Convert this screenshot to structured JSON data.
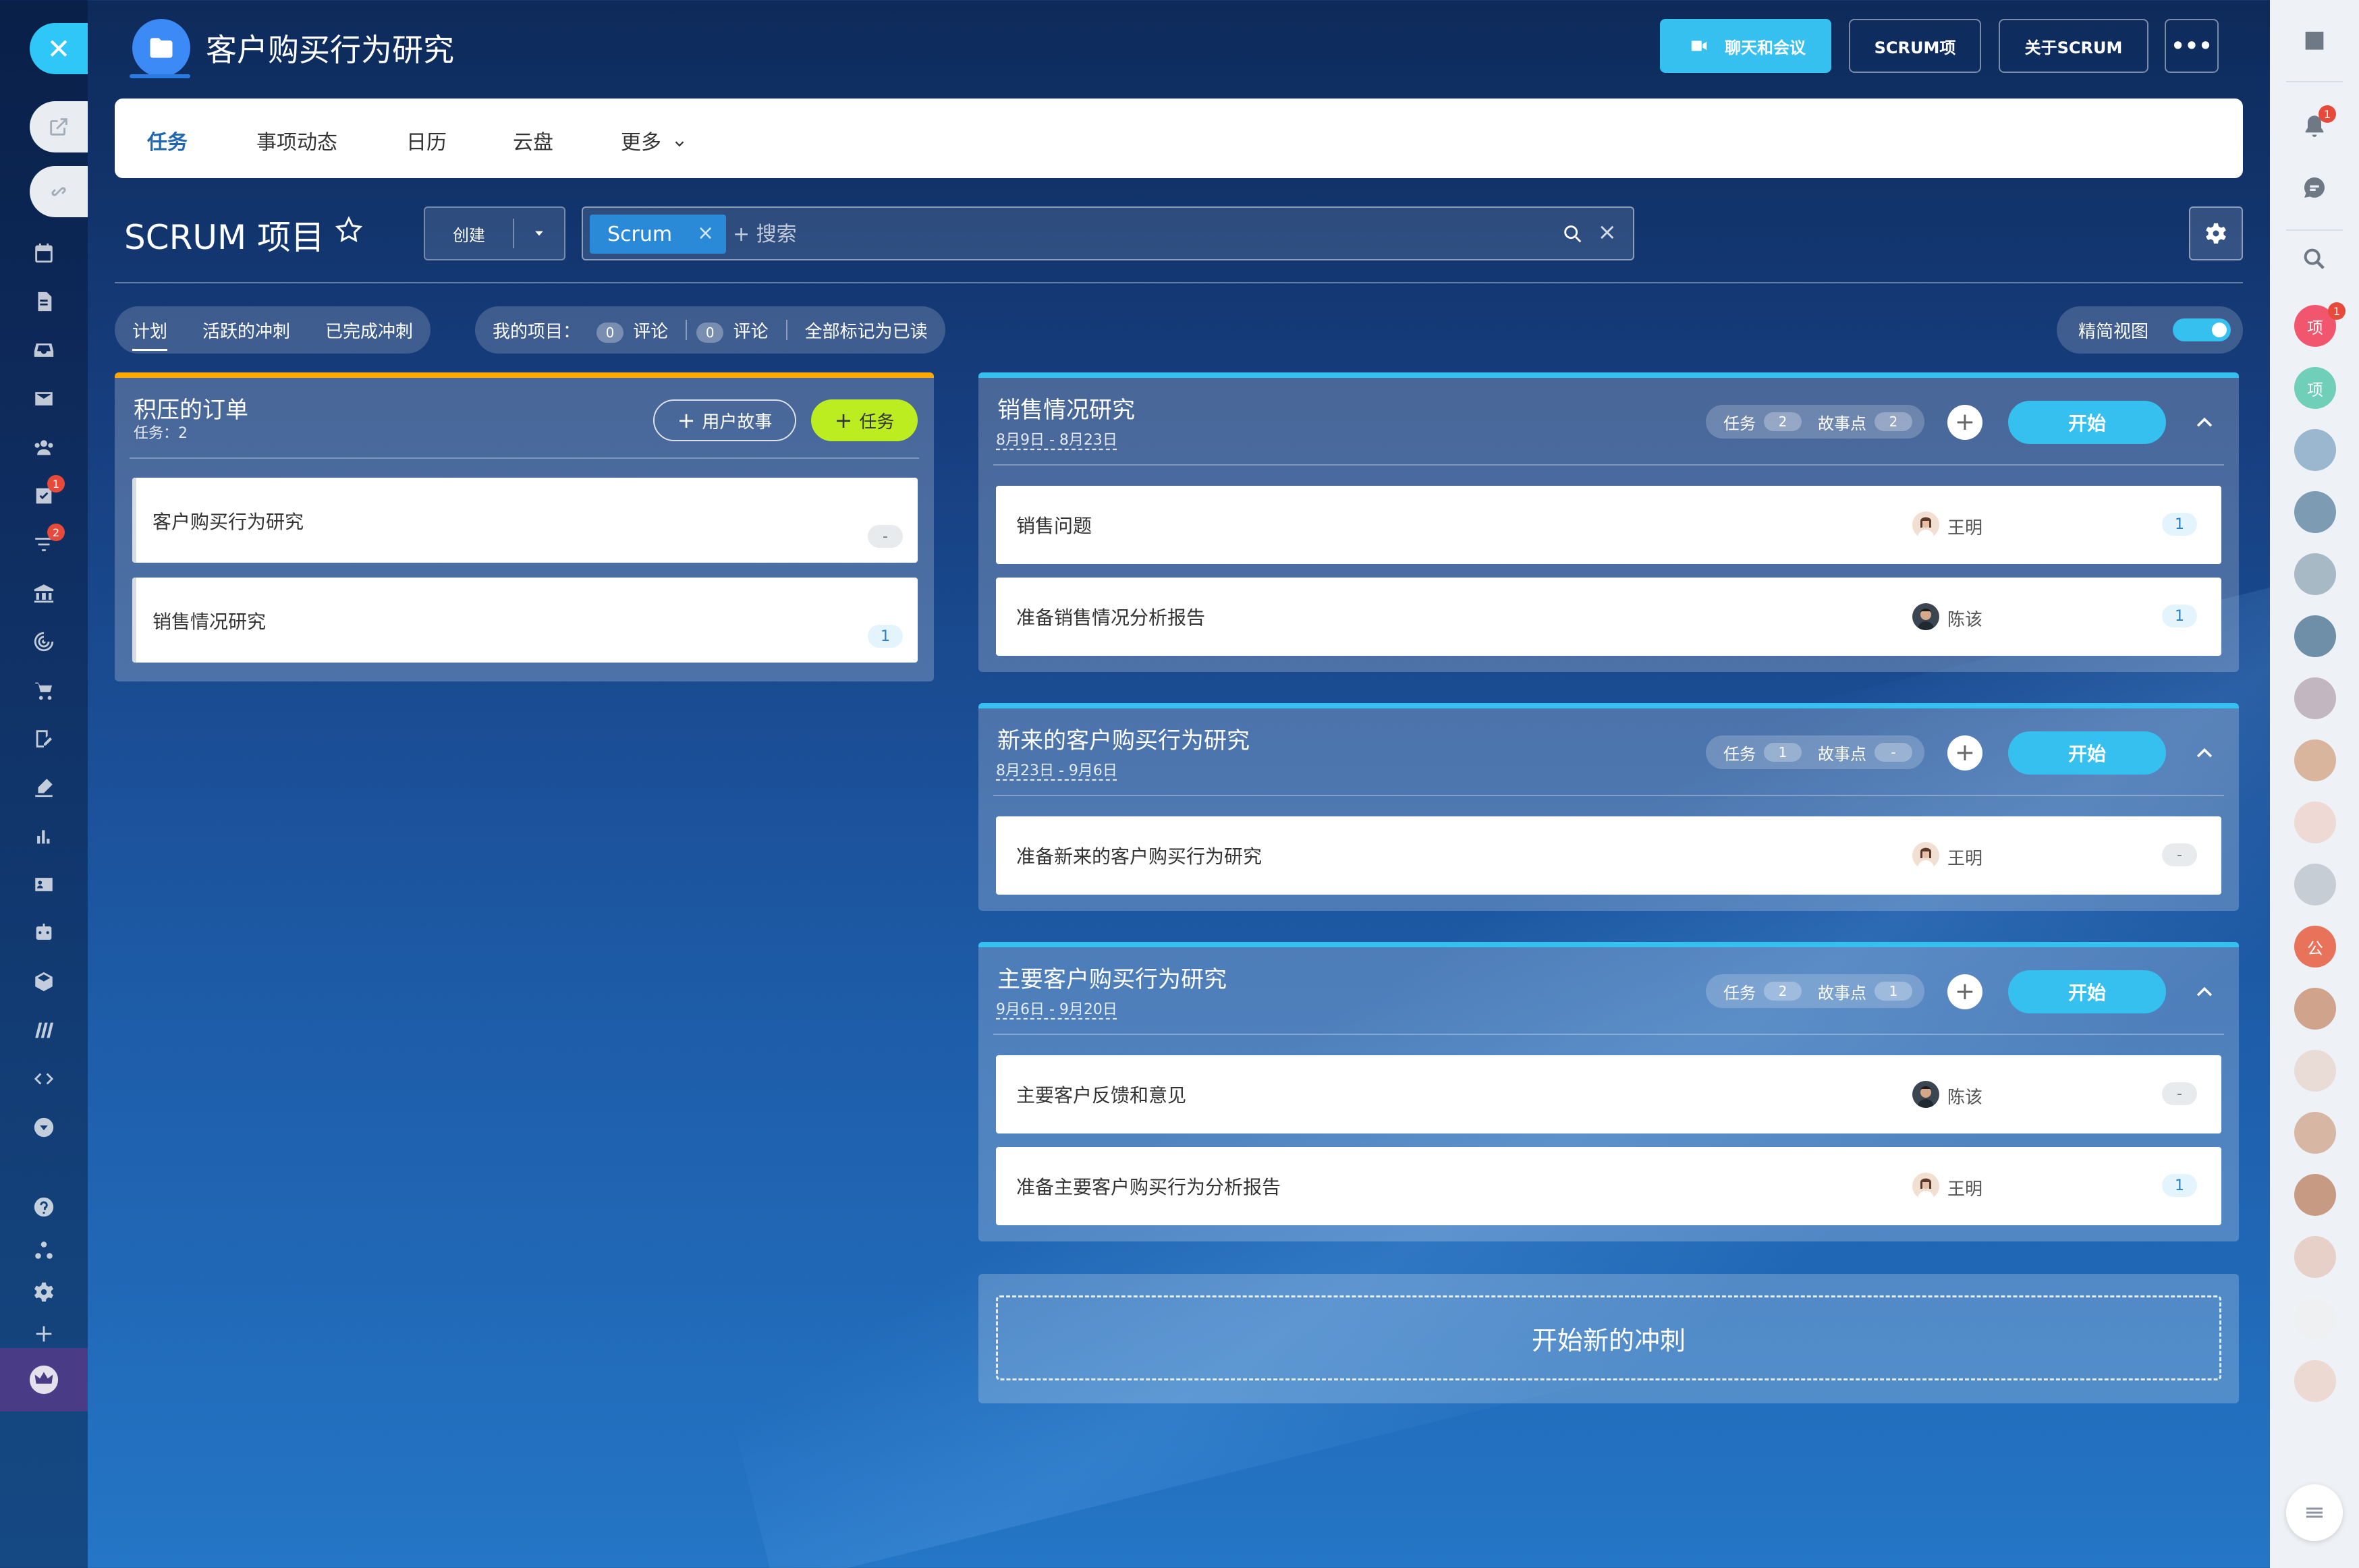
{
  "window": {
    "title": "客户购买行为研究",
    "buttons": {
      "video_label": "聊天和会议",
      "scrum_label": "SCRUM项",
      "about_label": "关于SCRUM",
      "more_label": "•••"
    }
  },
  "tabs": [
    {
      "label": "任务",
      "active": true
    },
    {
      "label": "事项动态",
      "active": false
    },
    {
      "label": "日历",
      "active": false
    },
    {
      "label": "云盘",
      "active": false
    },
    {
      "label": "更多",
      "active": false
    }
  ],
  "project": {
    "title": "SCRUM 项目",
    "create_label": "创建",
    "search": {
      "chip": "Scrum",
      "placeholder": "+ 搜索"
    }
  },
  "filters": {
    "views": [
      "计划",
      "活跃的冲刺",
      "已完成冲刺"
    ],
    "active_view": "计划",
    "my_items_label": "我的项目：",
    "comments": [
      {
        "count": "0",
        "label": "评论"
      },
      {
        "count": "0",
        "label": "评论"
      }
    ],
    "mark_all_read": "全部标记为已读",
    "compact_view_label": "精简视图",
    "compact_view_on": true
  },
  "backlog": {
    "title": "积压的订单",
    "subtitle": "任务：2",
    "add_story_label": "用户故事",
    "add_task_label": "任务",
    "items": [
      {
        "title": "客户购买行为研究",
        "points": "-"
      },
      {
        "title": "销售情况研究",
        "points": "1"
      }
    ]
  },
  "sprints": [
    {
      "title": "销售情况研究",
      "dates": "8月9日 - 8月23日",
      "tasks_label": "任务",
      "tasks_count": "2",
      "points_label": "故事点",
      "points_count": "2",
      "start_label": "开始",
      "items": [
        {
          "title": "销售问题",
          "assignee": "王明",
          "points": "1"
        },
        {
          "title": "准备销售情况分析报告",
          "assignee": "陈该",
          "points": "1"
        }
      ]
    },
    {
      "title": "新来的客户购买行为研究",
      "dates": "8月23日 - 9月6日",
      "tasks_label": "任务",
      "tasks_count": "1",
      "points_label": "故事点",
      "points_count": "-",
      "start_label": "开始",
      "items": [
        {
          "title": "准备新来的客户购买行为研究",
          "assignee": "王明",
          "points": "-"
        }
      ]
    },
    {
      "title": "主要客户购买行为研究",
      "dates": "9月6日 - 9月20日",
      "tasks_label": "任务",
      "tasks_count": "2",
      "points_label": "故事点",
      "points_count": "1",
      "start_label": "开始",
      "items": [
        {
          "title": "主要客户反馈和意见",
          "assignee": "陈该",
          "points": "-"
        },
        {
          "title": "准备主要客户购买行为分析报告",
          "assignee": "王明",
          "points": "1"
        }
      ]
    }
  ],
  "new_sprint_label": "开始新的冲刺",
  "left_rail": {
    "badges": [
      "1",
      "2"
    ]
  },
  "right_rail": {
    "notification_badge": "1",
    "project_badge": "1",
    "project_avatar_labels": [
      "项",
      "项"
    ],
    "org_label": "公"
  },
  "colors": {
    "accent": "#35c0ef",
    "backlog_border": "#ffa800",
    "add_task": "#bbed21",
    "tab_active": "#2067b0"
  }
}
